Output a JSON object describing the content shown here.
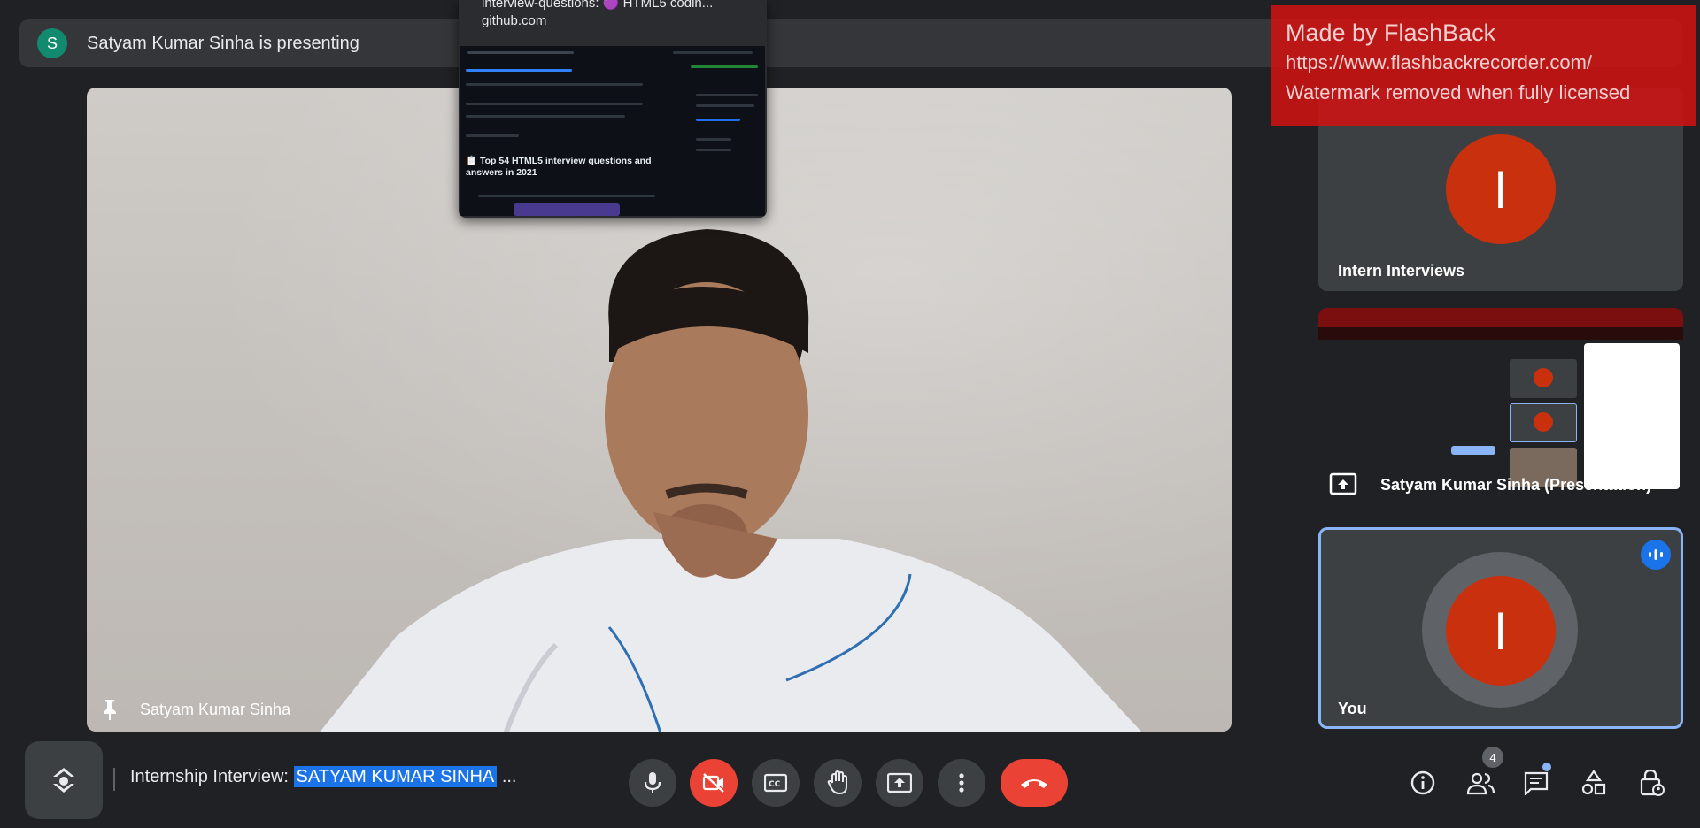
{
  "presenting_bar": {
    "avatar_letter": "S",
    "text": "Satyam Kumar Sinha is presenting"
  },
  "main_video": {
    "participant_name": "Satyam Kumar Sinha"
  },
  "github_preview": {
    "title": "interview-questions: 🟣 HTML5 codin...",
    "domain": "github.com",
    "repo_heading": "📋 Top 54 HTML5 interview questions and answers in 2021"
  },
  "tiles": [
    {
      "name": "Intern Interviews",
      "avatar_letter": "I"
    },
    {
      "name": "Satyam Kumar Sinha (Presentation)"
    },
    {
      "name": "You",
      "avatar_letter": "I"
    }
  ],
  "watermark": {
    "line1": "Made by FlashBack",
    "line2": "https://www.flashbackrecorder.com/",
    "line3": "Watermark removed when fully licensed"
  },
  "meeting": {
    "title_prefix": "Internship Interview: ",
    "title_selected": "SATYAM KUMAR SINHA",
    "title_suffix": " ..."
  },
  "controls": {
    "icons": [
      "microphone-icon",
      "camera-off-icon",
      "captions-icon",
      "raise-hand-icon",
      "present-screen-icon",
      "more-options-icon",
      "end-call-icon"
    ]
  },
  "right_controls": {
    "people_count": "4"
  },
  "colors": {
    "end_red": "#ea4335",
    "accent_blue": "#1a73e8",
    "avatar_orange": "#c9300e"
  }
}
